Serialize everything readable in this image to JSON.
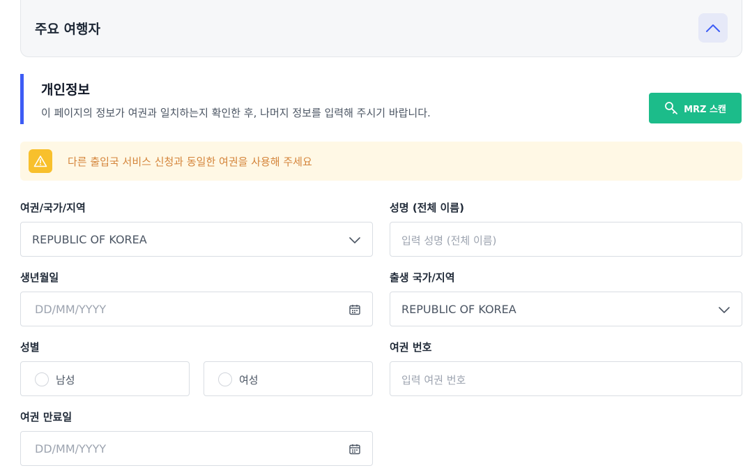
{
  "section": {
    "title": "주요 여행자",
    "collapse_icon": "chevron-up-icon"
  },
  "info": {
    "title": "개인정보",
    "description": "이 페이지의 정보가 여권과 일치하는지 확인한 후, 나머지 정보를 입력해 주시기 바랍니다."
  },
  "mrz_button": {
    "label": "MRZ 스캔",
    "icon": "key-icon"
  },
  "warning": {
    "text": "다른 출입국 서비스 신청과 동일한 여권을 사용해 주세요",
    "icon": "warning-icon"
  },
  "form": {
    "passport_country": {
      "label": "여권/국가/지역",
      "value": "REPUBLIC OF KOREA"
    },
    "full_name": {
      "label": "성명 (전체 이름)",
      "placeholder": "입력 성명 (전체 이름)"
    },
    "birth_date": {
      "label": "생년월일",
      "placeholder": "DD/MM/YYYY"
    },
    "birth_country": {
      "label": "출생 국가/지역",
      "value": "REPUBLIC OF KOREA"
    },
    "gender": {
      "label": "성별",
      "options": [
        "남성",
        "여성"
      ]
    },
    "passport_number": {
      "label": "여권 번호",
      "placeholder": "입력 여권 번호"
    },
    "passport_expiry": {
      "label": "여권 만료일",
      "placeholder": "DD/MM/YYYY"
    }
  },
  "colors": {
    "accent": "#3d5cf5",
    "mrz_green": "#1cbc8a",
    "warning_bg": "#fff8e5",
    "warning_text": "#d4843a"
  }
}
